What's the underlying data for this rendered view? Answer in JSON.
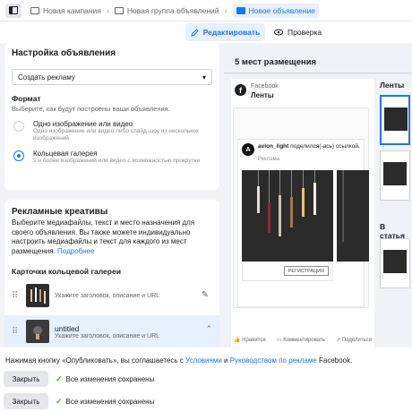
{
  "breadcrumbs": {
    "campaign": "Новая кампания",
    "adset": "Новая группа объявлений",
    "ad": "Новое объявление"
  },
  "modes": {
    "edit": "Редактировать",
    "review": "Проверка"
  },
  "ad_settings": {
    "title": "Настройка объявления",
    "create_select": "Создать рекламу",
    "format_title": "Формат",
    "format_desc": "Выберите, как будут построены ваши объявления.",
    "options": [
      {
        "label": "Одно изображение или видео",
        "desc": "Одно изображение или видео либо слайд-шоу из нескольких изображений",
        "selected": false
      },
      {
        "label": "Кольцевая галерея",
        "desc": "2 и более изображений или видео с возможностью прокрутки",
        "selected": true
      }
    ]
  },
  "creatives": {
    "title": "Рекламные креативы",
    "text": "Выберите медиафайлы, текст и место назначения для своего объявления. Вы также можете индивидуально настроить медиафайлы и текст для каждого из мест размещения.",
    "more_link": "Подробнее",
    "carousel_title": "Карточки кольцевой галереи",
    "cards": [
      {
        "title": "",
        "desc": "Укажите заголовок, описание и URL"
      },
      {
        "title": "untitled",
        "desc": "Укажите заголовок, описание и URL"
      }
    ]
  },
  "preview": {
    "placements_title": "5 мест размещения",
    "platform": "Facebook",
    "feed": "Ленты",
    "post_author": "avion_light",
    "post_action": "поделился(-ась) ссылкой.",
    "post_sub": "Реклама",
    "cta": "РЕГИСТРАЦИЯ",
    "like": "Нравится",
    "comment": "Комментировать",
    "share": "Поделиться",
    "side_feeds": "Ленты",
    "side_articles": "В статья"
  },
  "footer": {
    "consent_prefix": "Нажимая кнопку «Опубликовать», вы соглашаетесь с ",
    "terms": "Условиями",
    "and": " и ",
    "guide": "Руководством по рекламе",
    "suffix": " Facebook.",
    "close1": "Закрыть",
    "saved1": "Все изменения сохранены",
    "close2": "Закрыть",
    "saved2": "Все изменения сохранены"
  },
  "colors": {
    "accent": "#1877f2",
    "success": "#42b72a"
  }
}
